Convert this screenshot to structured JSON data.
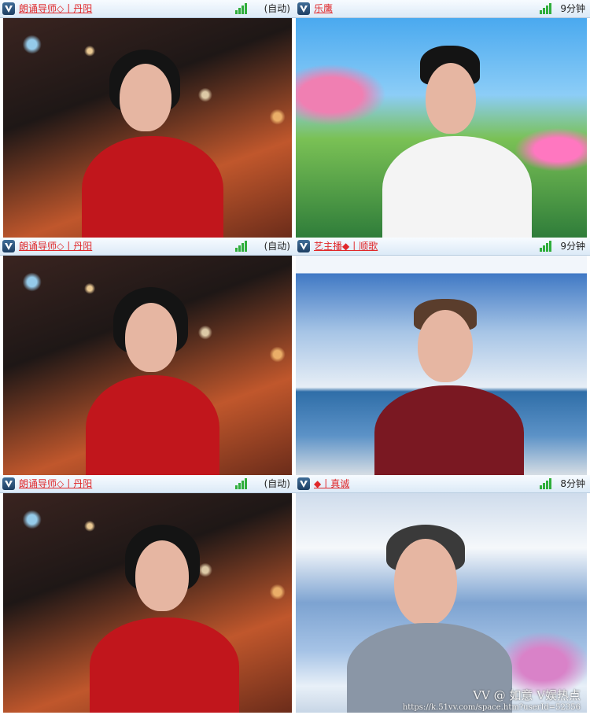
{
  "tiles": [
    {
      "name": "朗诵导师◇丨丹阳",
      "status": "(自动)"
    },
    {
      "name": "乐鹰",
      "status": "9分钟"
    },
    {
      "name": "朗诵导师◇丨丹阳",
      "status": "(自动)"
    },
    {
      "name": "艺主播◆丨顺歌",
      "status": "9分钟"
    },
    {
      "name": "朗诵导师◇丨丹阳",
      "status": "(自动)"
    },
    {
      "name": "◆丨真诚",
      "status": "8分钟"
    }
  ],
  "watermark": {
    "text": "VV @ 如意    V娱热点",
    "url": "https://k.51vv.com/space.htm?userId=52356"
  },
  "colors": {
    "name": "#e0282a",
    "signal": "#2fae3b",
    "header": "#dceaf7"
  },
  "icons": {
    "logo": "vv-logo-icon",
    "signal": "signal-bars-icon"
  }
}
